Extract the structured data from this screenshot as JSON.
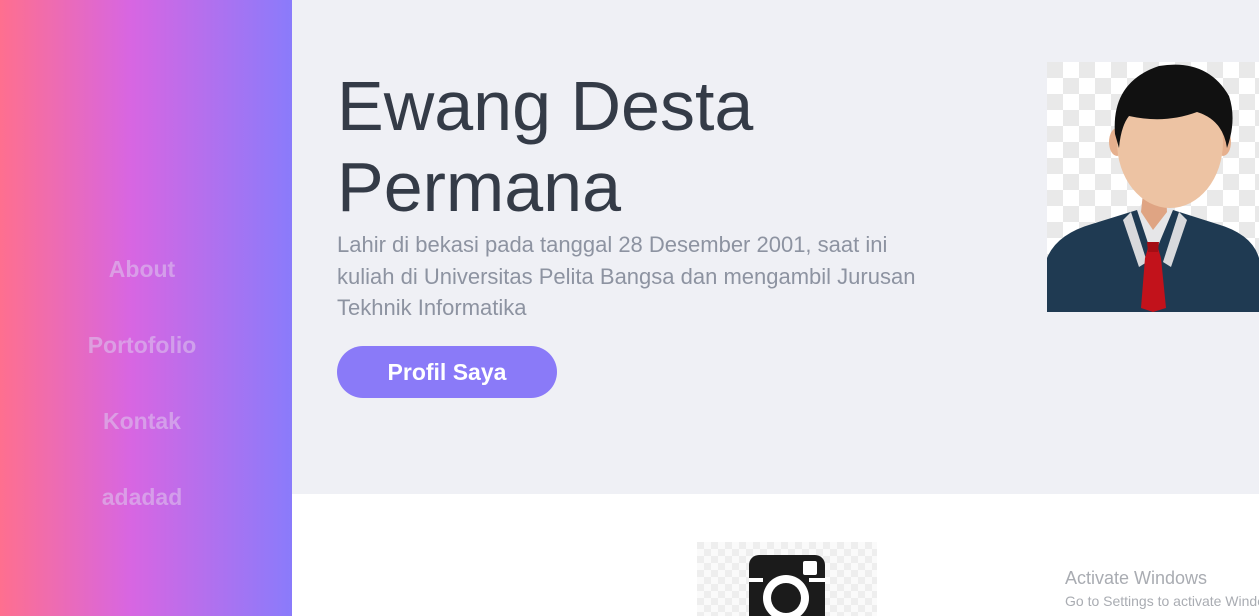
{
  "nav": {
    "items": [
      {
        "label": "About"
      },
      {
        "label": "Portofolio"
      },
      {
        "label": "Kontak"
      },
      {
        "label": "adadad"
      }
    ]
  },
  "hero": {
    "title": "Ewang Desta Permana",
    "description": "Lahir di bekasi pada tanggal 28 Desember 2001, saat ini kuliah di Universitas Pelita Bangsa dan mengambil Jurusan Tekhnik Informatika",
    "button_label": "Profil Saya",
    "avatar_icon": "person-avatar-icon"
  },
  "lower": {
    "icon": "instagram-icon"
  },
  "watermark": {
    "title": "Activate Windows",
    "subtitle": "Go to Settings to activate Windows."
  },
  "colors": {
    "gradient_start": "#fe6f8f",
    "gradient_mid": "#d766e2",
    "gradient_end": "#8a7bfb",
    "button": "#8a7af8",
    "title_text": "#343b47",
    "hero_bg": "#eff0f5"
  }
}
